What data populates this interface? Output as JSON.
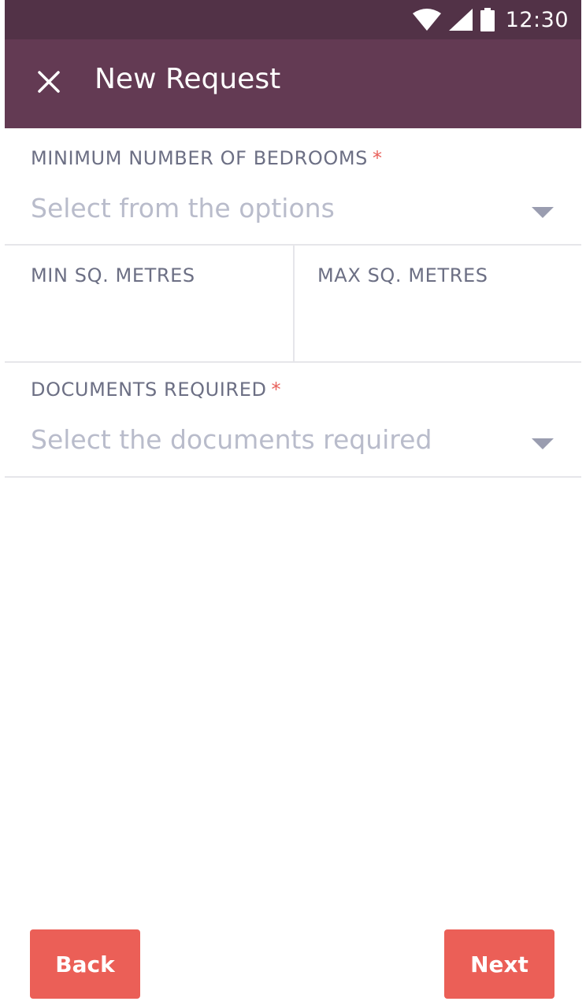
{
  "status_bar": {
    "time": "12:30",
    "icons": [
      "wifi-icon",
      "signal-icon",
      "battery-icon"
    ]
  },
  "app_bar": {
    "title": "New Request",
    "close_icon": "close-icon"
  },
  "form": {
    "bedrooms": {
      "label": "MINIMUM NUMBER OF BEDROOMS",
      "required_mark": "*",
      "placeholder": "Select from the options"
    },
    "min_sq": {
      "label": "MIN SQ. METRES"
    },
    "max_sq": {
      "label": "MAX SQ. METRES"
    },
    "documents": {
      "label": "DOCUMENTS REQUIRED",
      "required_mark": "*",
      "placeholder": "Select the documents required"
    }
  },
  "actions": {
    "back": "Back",
    "next": "Next"
  },
  "colors": {
    "status_bar": "#523247",
    "app_bar": "#633a53",
    "accent_button": "#eb5f57",
    "label": "#6c6f84",
    "placeholder": "#b9bccb",
    "required": "#e8605a"
  }
}
